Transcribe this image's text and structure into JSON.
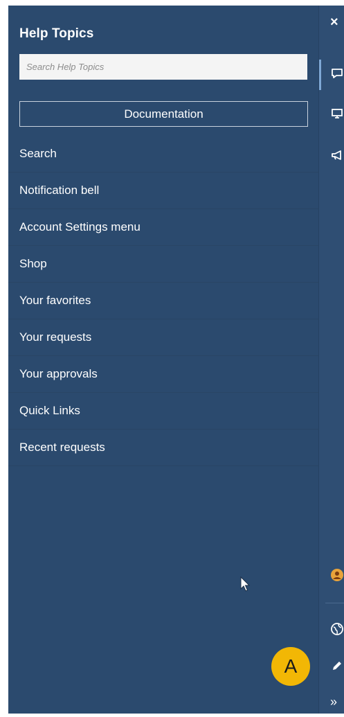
{
  "panel": {
    "title": "Help Topics",
    "search_placeholder": "Search Help Topics",
    "documentation_label": "Documentation",
    "topics": [
      "Search",
      "Notification bell",
      "Account Settings menu",
      "Shop",
      "Your favorites",
      "Your requests",
      "Your approvals",
      "Quick Links",
      "Recent requests"
    ]
  },
  "rail": {
    "close_glyph": "×",
    "icons": [
      "close-icon",
      "chat-icon",
      "screen-share-icon",
      "megaphone-icon",
      "avatar-icon",
      "globe-icon",
      "edit-icon",
      "expand-icon"
    ],
    "expand_glyph": "»"
  },
  "annotation": {
    "badge_label": "A"
  },
  "colors": {
    "panel_bg": "#2b4a6e",
    "rail_bg": "#2f4e73",
    "badge": "#f2b705",
    "avatar": "#e9a33a"
  }
}
